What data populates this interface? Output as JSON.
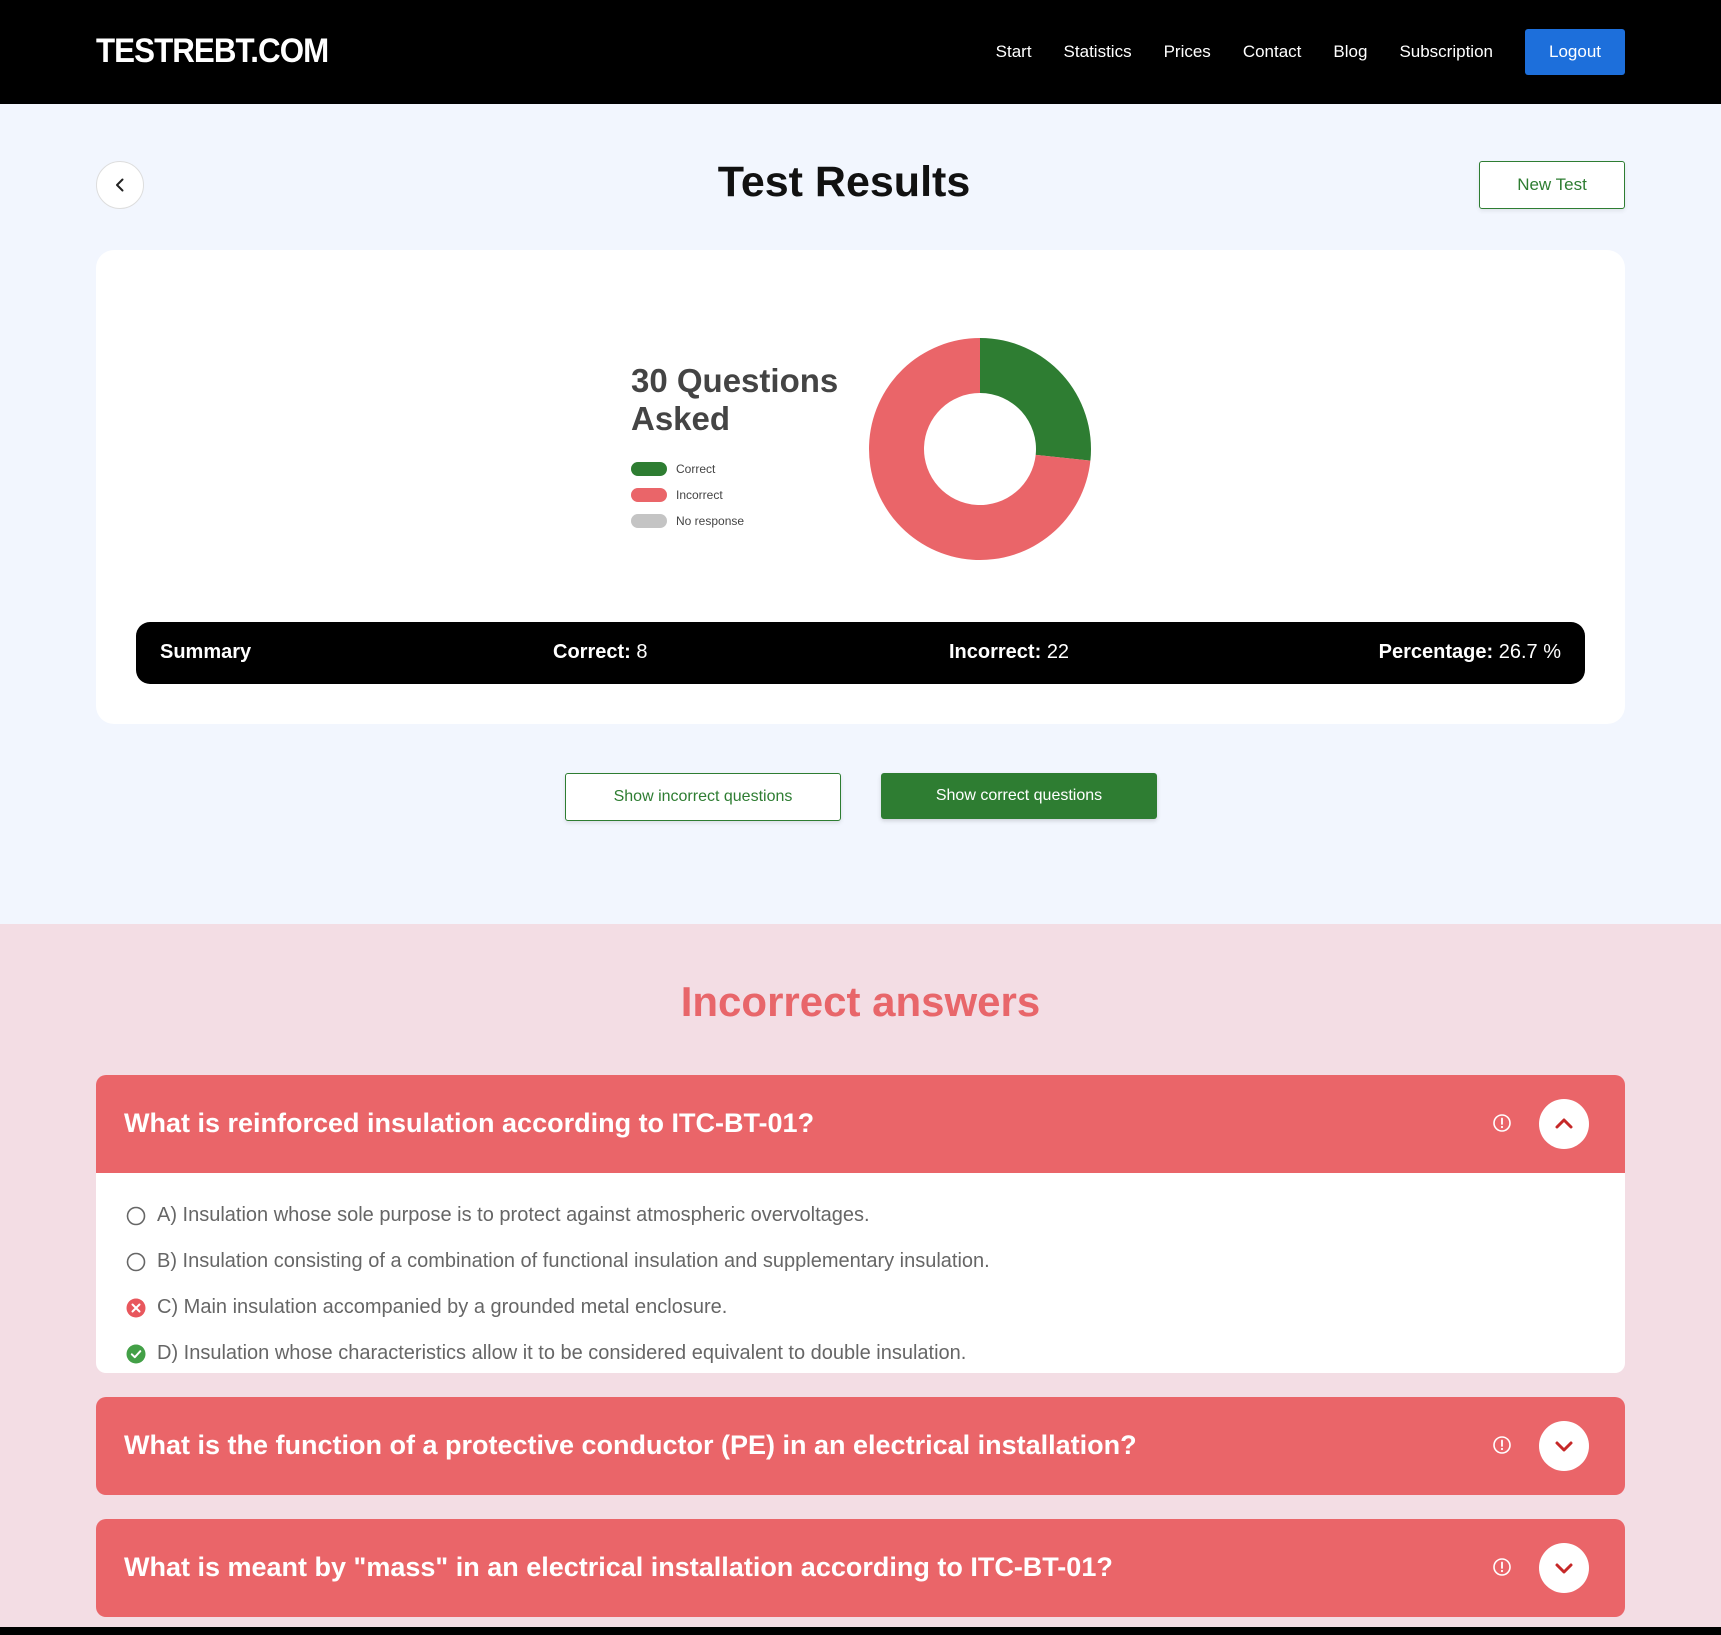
{
  "header": {
    "logo": "TESTREBT.COM",
    "nav": [
      "Start",
      "Statistics",
      "Prices",
      "Contact",
      "Blog",
      "Subscription"
    ],
    "logout_label": "Logout"
  },
  "page": {
    "title": "Test Results",
    "new_test_label": "New Test"
  },
  "results": {
    "questions_title": "30 Questions Asked",
    "legend": [
      {
        "label": "Correct",
        "color": "#2e7d32"
      },
      {
        "label": "Incorrect",
        "color": "#ea6569"
      },
      {
        "label": "No response",
        "color": "#c4c4c4"
      }
    ]
  },
  "chart_data": {
    "type": "pie",
    "categories": [
      "Correct",
      "Incorrect",
      "No response"
    ],
    "values": [
      8,
      22,
      0
    ],
    "colors": [
      "#2e7d32",
      "#ea6569",
      "#c4c4c4"
    ],
    "title": "30 Questions Asked",
    "donut": true,
    "legend_position": "left"
  },
  "summary": {
    "label": "Summary",
    "correct_key": "Correct:",
    "correct_value": "8",
    "incorrect_key": "Incorrect:",
    "incorrect_value": "22",
    "percentage_key": "Percentage:",
    "percentage_value": "26.7 %"
  },
  "actions": {
    "show_incorrect": "Show incorrect questions",
    "show_correct": "Show correct questions"
  },
  "incorrect_section": {
    "title": "Incorrect answers",
    "questions": [
      {
        "text": "What is reinforced insulation according to ITC-BT-01?",
        "expanded": true,
        "answers": [
          {
            "text": "A) Insulation whose sole purpose is to protect against atmospheric overvoltages.",
            "state": "unselected"
          },
          {
            "text": "B) Insulation consisting of a combination of functional insulation and supplementary insulation.",
            "state": "unselected"
          },
          {
            "text": "C) Main insulation accompanied by a grounded metal enclosure.",
            "state": "wrong"
          },
          {
            "text": "D) Insulation whose characteristics allow it to be considered equivalent to double insulation.",
            "state": "correct"
          }
        ]
      },
      {
        "text": "What is the function of a protective conductor (PE) in an electrical installation?",
        "expanded": false
      },
      {
        "text": "What is meant by \"mass\" in an electrical installation according to ITC-BT-01?",
        "expanded": false
      }
    ]
  },
  "icons": {
    "back": "chevron-left-icon",
    "info": "info-circle-icon",
    "collapse": "chevron-up-icon",
    "expand": "chevron-down-icon",
    "wrong": "x-circle-icon",
    "right": "check-circle-icon",
    "radio": "radio-empty-icon"
  }
}
